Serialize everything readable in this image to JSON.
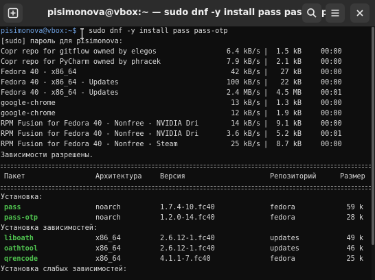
{
  "window": {
    "title": "pisimonova@vbox:~ — sudo dnf -y install pass pass-otp",
    "icons": {
      "new_tab": "new-tab-icon",
      "search": "search-icon",
      "menu": "hamburger-menu-icon",
      "close": "close-icon"
    }
  },
  "colors": {
    "titlebar": "#2c2c2c",
    "background": "#0e0e0e",
    "prompt": "#6b9bd8",
    "package_name": "#4fc24f",
    "text": "#d8d8d8"
  },
  "terminal": {
    "prompt": "pisimonova@vbox:~$",
    "command": " sudo dnf -y install pass pass-otp",
    "sudo_prompt": "[sudo] пароль для pisimonova:",
    "repos": [
      {
        "name": "Copr repo for gitflow owned by elegos",
        "speed": "6.4 kB/s",
        "size": "1.5 kB",
        "time": "00:00"
      },
      {
        "name": "Copr repo for PyCharm owned by phracek",
        "speed": "7.9 kB/s",
        "size": "2.1 kB",
        "time": "00:00"
      },
      {
        "name": "Fedora 40 - x86_64",
        "speed": "42 kB/s",
        "size": "27 kB",
        "time": "00:00"
      },
      {
        "name": "Fedora 40 - x86_64 - Updates",
        "speed": "100 kB/s",
        "size": "22 kB",
        "time": "00:00"
      },
      {
        "name": "Fedora 40 - x86_64 - Updates",
        "speed": "2.4 MB/s",
        "size": "4.5 MB",
        "time": "00:01"
      },
      {
        "name": "google-chrome",
        "speed": "13 kB/s",
        "size": "1.3 kB",
        "time": "00:00"
      },
      {
        "name": "google-chrome",
        "speed": "12 kB/s",
        "size": "1.9 kB",
        "time": "00:00"
      },
      {
        "name": "RPM Fusion for Fedora 40 - Nonfree - NVIDIA Dri",
        "speed": "14 kB/s",
        "size": "9.1 kB",
        "time": "00:00"
      },
      {
        "name": "RPM Fusion for Fedora 40 - Nonfree - NVIDIA Dri",
        "speed": "3.6 kB/s",
        "size": "5.2 kB",
        "time": "00:01"
      },
      {
        "name": "RPM Fusion for Fedora 40 - Nonfree - Steam",
        "speed": "25 kB/s",
        "size": "8.7 kB",
        "time": "00:00"
      }
    ],
    "deps_resolved": "Зависимости разрешены.",
    "table_headers": {
      "package": "Пакет",
      "arch": "Архитектура",
      "version": "Версия",
      "repo": "Репозиторий",
      "size": "Размер"
    },
    "install_label": "Установка:",
    "install": [
      {
        "name": "pass",
        "arch": "noarch",
        "version": "1.7.4-10.fc40",
        "repo": "fedora",
        "size": "59 k"
      },
      {
        "name": "pass-otp",
        "arch": "noarch",
        "version": "1.2.0-14.fc40",
        "repo": "fedora",
        "size": "28 k"
      }
    ],
    "deps_label": "Установка зависимостей:",
    "deps": [
      {
        "name": "liboath",
        "arch": "x86_64",
        "version": "2.6.12-1.fc40",
        "repo": "updates",
        "size": "49 k"
      },
      {
        "name": "oathtool",
        "arch": "x86_64",
        "version": "2.6.12-1.fc40",
        "repo": "updates",
        "size": "46 k"
      },
      {
        "name": "qrencode",
        "arch": "x86_64",
        "version": "4.1.1-7.fc40",
        "repo": "fedora",
        "size": "25 k"
      }
    ],
    "weak_deps_label": "Установка слабых зависимостей:"
  }
}
